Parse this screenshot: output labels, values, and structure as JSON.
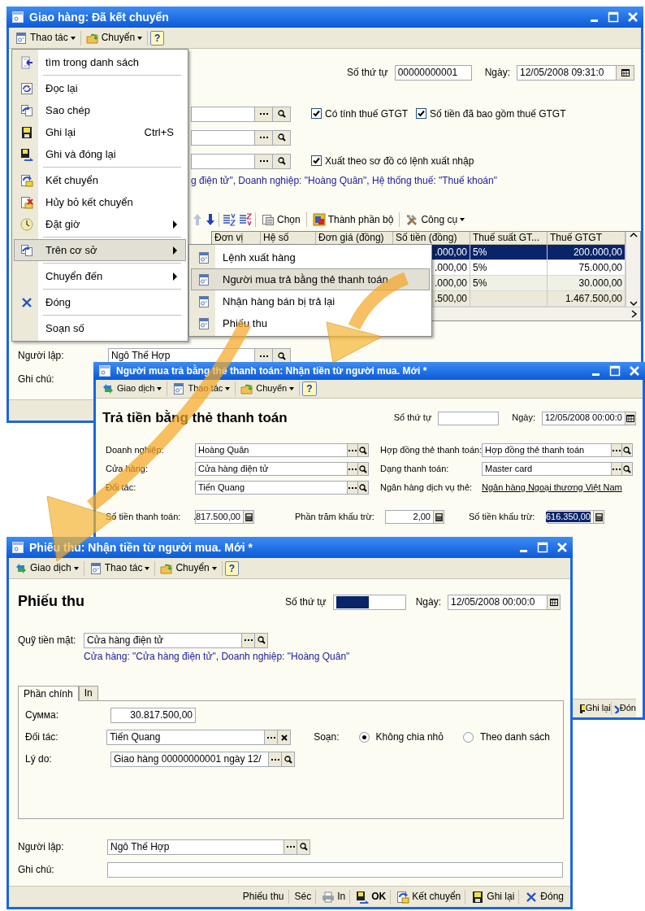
{
  "main_window": {
    "title": "Giao hàng: Đã kết chuyển",
    "toolbar": [
      {
        "kind": "actions",
        "label": "Thao tác",
        "dropdown": true
      },
      {
        "kind": "navigate",
        "label": "Chuyển",
        "dropdown": true
      },
      {
        "kind": "help",
        "label": "?"
      }
    ],
    "number": {
      "label": "Số thứ tự",
      "value": "00000000001"
    },
    "date": {
      "label": "Ngày:",
      "value": "12/05/2008 09:31:0"
    },
    "form_rows": [
      {
        "kind": "lookup",
        "checkboxes": [
          {
            "label": "Có tính thuế GTGT",
            "checked": true
          },
          {
            "label": "Số tiền đã bao gồm thuế GTGT",
            "checked": true
          }
        ]
      },
      {
        "kind": "lookup"
      },
      {
        "kind": "lookup",
        "checkboxes": [
          {
            "label": "Xuất theo sơ đồ có lệnh xuất nhập",
            "checked": true
          }
        ]
      }
    ],
    "info": "g điện tử\", Doanh nghiệp: \"Hoàng Quân\", Hệ thống thuế: \"Thuế khoán\"",
    "table_toolbar": [
      {
        "label": "Chọn"
      },
      {
        "label": "Thành phần bộ"
      },
      {
        "label": "Công cụ",
        "dropdown": true
      }
    ],
    "table": {
      "columns": [
        "Đơn vị",
        "Hệ số",
        "Đơn giá (đồng)",
        "Số tiền (đồng)",
        "Thuế suất GT...",
        "Thuế GTGT"
      ],
      "rows": [
        {
          "kind": "item",
          "amount": ".000,00",
          "rate": "5%",
          "vat": "200.000,00",
          "selected": true
        },
        {
          "kind": "item",
          "amount": ".000,00",
          "rate": "5%",
          "vat": "75.000,00",
          "selected": false
        },
        {
          "kind": "item",
          "amount": ".000,00",
          "rate": "5%",
          "vat": "30.000,00",
          "selected": false
        },
        {
          "kind": "total",
          "amount": ".500,00",
          "vat": "1.467.500,00",
          "selected": false
        }
      ]
    },
    "author": {
      "label": "Người lập:",
      "value": "Ngô Thế Hợp"
    },
    "note": {
      "label": "Ghi chú:"
    }
  },
  "context_menu": {
    "items": [
      {
        "kind": "command",
        "label": "tìm trong danh sách",
        "selected": false
      },
      {
        "kind": "separator"
      },
      {
        "kind": "command",
        "label": "Đọc lại",
        "selected": false
      },
      {
        "kind": "command",
        "label": "Sao chép",
        "selected": false
      },
      {
        "kind": "command",
        "label": "Ghi lại",
        "shortcut": "Ctrl+S",
        "selected": false
      },
      {
        "kind": "command",
        "label": "Ghi và đóng lại",
        "selected": false
      },
      {
        "kind": "separator"
      },
      {
        "kind": "command",
        "label": "Kết chuyển",
        "selected": false
      },
      {
        "kind": "command",
        "label": "Hủy bỏ kết chuyển",
        "selected": false
      },
      {
        "kind": "submenu",
        "label": "Đặt giờ",
        "selected": false
      },
      {
        "kind": "separator"
      },
      {
        "kind": "submenu",
        "label": "Trên cơ sở",
        "selected": true
      },
      {
        "kind": "separator"
      },
      {
        "kind": "submenu",
        "label": "Chuyển đến",
        "selected": false
      },
      {
        "kind": "separator"
      },
      {
        "kind": "command",
        "label": "Đóng",
        "selected": false
      },
      {
        "kind": "separator"
      },
      {
        "kind": "command",
        "label": "Soạn số",
        "selected": false
      }
    ]
  },
  "submenu": {
    "items": [
      {
        "label": "Lệnh xuất hàng",
        "selected": false
      },
      {
        "label": "Người mua trả bằng thẻ thanh toán",
        "selected": true
      },
      {
        "label": "Nhận hàng bán bị trả lại",
        "selected": false
      },
      {
        "label": "Phiếu thu",
        "selected": false
      }
    ]
  },
  "card_window": {
    "title": "Người mua trả bằng thẻ thanh toán: Nhận tiền từ người mua. Mới *",
    "toolbar": [
      {
        "kind": "transaction",
        "label": "Giao dịch",
        "dropdown": true
      },
      {
        "kind": "actions",
        "label": "Thao tác",
        "dropdown": true
      },
      {
        "kind": "navigate",
        "label": "Chuyển",
        "dropdown": true
      },
      {
        "kind": "help",
        "label": "?"
      }
    ],
    "heading": "Trả tiền bằng thẻ thanh toán",
    "number": {
      "label": "Số thứ tự"
    },
    "date": {
      "label": "Ngày:",
      "value": "12/05/2008 00:00:0"
    },
    "left_fields": [
      {
        "label": "Doanh nghiệp:",
        "value": "Hoàng Quân"
      },
      {
        "label": "Cửa hàng:",
        "value": "Cửa hàng điện tử"
      },
      {
        "label": "Đối tác:",
        "value": "Tiến Quang"
      }
    ],
    "right_fields": [
      {
        "kind": "lookup",
        "label": "Hợp đồng thẻ thanh toán:",
        "value": "Hợp đồng thẻ thanh toán"
      },
      {
        "kind": "lookup",
        "label": "Dạng thanh toán:",
        "value": "Master card"
      },
      {
        "kind": "link",
        "label": "Ngân hàng dịch vụ thẻ:",
        "value": "Ngân hàng Ngoại thương Việt Nam"
      }
    ],
    "amounts": [
      {
        "label": "Số tiền thanh toán:",
        "value": ".817.500,00",
        "selected": false
      },
      {
        "label": "Phần trăm khấu trừ:",
        "value": "2,00",
        "selected": false
      },
      {
        "label": "Số tiền khấu trừ:",
        "value": "616.350,00",
        "selected": true
      }
    ],
    "footer_buttons": [
      {
        "kind": "save",
        "label": "Ghi lại"
      },
      {
        "kind": "close",
        "label": "Đón"
      }
    ]
  },
  "receipt_window": {
    "title": "Phiếu thu: Nhận tiền từ người mua. Mới *",
    "toolbar": [
      {
        "kind": "transaction",
        "label": "Giao dịch",
        "dropdown": true
      },
      {
        "kind": "actions",
        "label": "Thao tác",
        "dropdown": true
      },
      {
        "kind": "navigate",
        "label": "Chuyển",
        "dropdown": true
      },
      {
        "kind": "help",
        "label": "?"
      }
    ],
    "heading": "Phiếu thu",
    "number": {
      "label": "Số thứ tự",
      "selected": true
    },
    "date": {
      "label": "Ngày:",
      "value": "12/05/2008 00:00:0"
    },
    "cash_fund": {
      "label": "Quỹ tiền mặt:",
      "value": "Cửa hàng điện tử"
    },
    "info": "Cửa hàng: \"Cửa hàng điện tử\", Doanh nghiệp: \"Hoàng Quân\"",
    "tabs": [
      {
        "label": "Phần chính",
        "selected": true
      },
      {
        "label": "In",
        "selected": false
      }
    ],
    "fields": [
      {
        "kind": "amount",
        "label": "Сумма:",
        "value": "30.817.500,00"
      },
      {
        "kind": "clearable",
        "label": "Đối tác:",
        "value": "Tiến Quang"
      },
      {
        "kind": "lookup",
        "label": "Lý do:",
        "value": "Giao hàng 00000000001 ngày 12/"
      }
    ],
    "split": {
      "label": "Soạn:",
      "options": [
        {
          "label": "Không chia nhỏ",
          "selected": true
        },
        {
          "label": "Theo danh sách",
          "selected": false
        }
      ]
    },
    "author": {
      "label": "Người lập:",
      "value": "Ngô Thế Hợp"
    },
    "note": {
      "label": "Ghi chú:"
    },
    "footer_buttons": [
      {
        "kind": "plain",
        "label": "Phiếu thu"
      },
      {
        "kind": "plain",
        "label": "Séc"
      },
      {
        "kind": "print",
        "label": "In"
      },
      {
        "kind": "ok",
        "label": "OK"
      },
      {
        "kind": "transfer",
        "label": "Kết chuyển"
      },
      {
        "kind": "save",
        "label": "Ghi lại"
      },
      {
        "kind": "close",
        "label": "Đóng"
      }
    ]
  }
}
